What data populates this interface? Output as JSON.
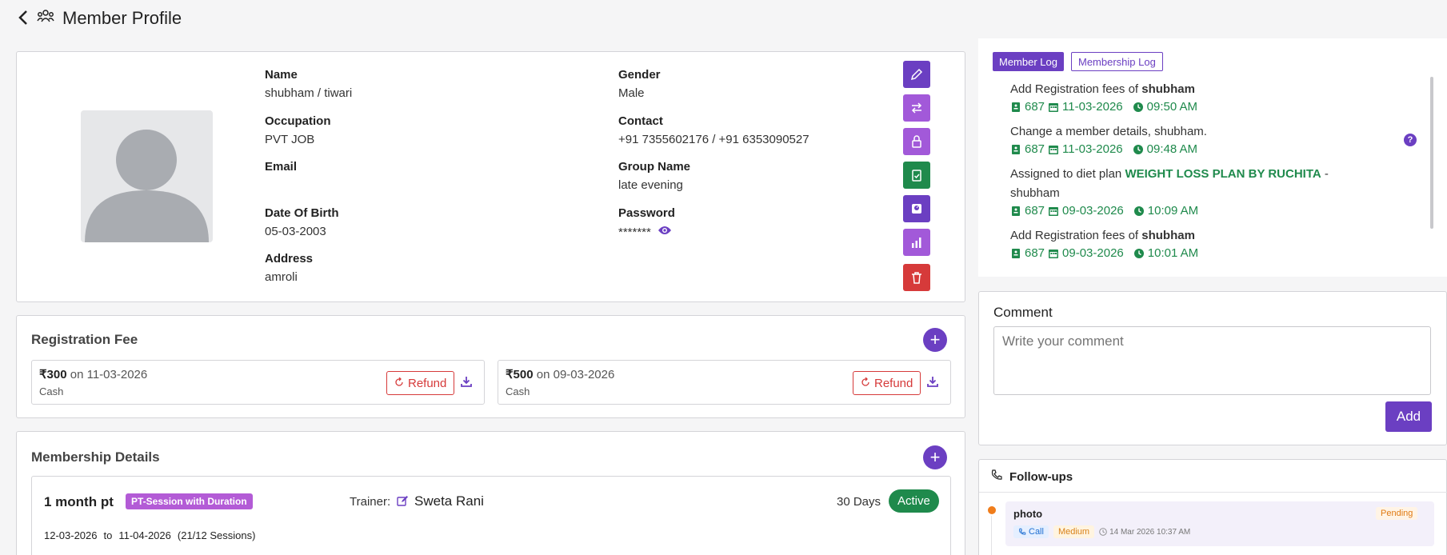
{
  "header": {
    "title": "Member Profile"
  },
  "profile": {
    "name_label": "Name",
    "name": "shubham / tiwari",
    "gender_label": "Gender",
    "gender": "Male",
    "occupation_label": "Occupation",
    "occupation": "PVT JOB",
    "contact_label": "Contact",
    "contact": "+91 7355602176 / +91 6353090527",
    "email_label": "Email",
    "email": "",
    "group_label": "Group Name",
    "group": "late evening",
    "dob_label": "Date Of Birth",
    "dob": "05-03-2003",
    "password_label": "Password",
    "password": "*******",
    "address_label": "Address",
    "address": "amroli"
  },
  "actions": {
    "colors": {
      "edit": "#6b3fc2",
      "transfer": "#a259d9",
      "lock": "#a259d9",
      "diet": "#1f8a4c",
      "measure": "#6b3fc2",
      "stats": "#a259d9",
      "delete": "#d63a3a"
    }
  },
  "registration": {
    "title": "Registration Fee",
    "fees": [
      {
        "amount": "₹300",
        "on": "on 11-03-2026",
        "mode": "Cash",
        "refund_label": "Refund"
      },
      {
        "amount": "₹500",
        "on": "on 09-03-2026",
        "mode": "Cash",
        "refund_label": "Refund"
      }
    ]
  },
  "membership": {
    "title": "Membership Details",
    "plan": "1 month pt",
    "tag": "PT-Session with Duration",
    "trainer_label": "Trainer:",
    "trainer": "Sweta Rani",
    "duration": "30 Days",
    "status": "Active",
    "start": "12-03-2026",
    "to": "to",
    "end": "11-04-2026",
    "sessions": "(21/12 Sessions)"
  },
  "logs": {
    "tabs": [
      "Member Log",
      "Membership Log"
    ],
    "entries": [
      {
        "pre": "Add Registration fees of ",
        "bold": "shubham",
        "post": "",
        "id": "687",
        "date": "11-03-2026",
        "time": "09:50 AM"
      },
      {
        "pre": "Change a member details, shubham.",
        "bold": "",
        "post": "",
        "id": "687",
        "date": "11-03-2026",
        "time": "09:48 AM"
      },
      {
        "pre": "Assigned to diet plan ",
        "bold": "WEIGHT LOSS PLAN BY RUCHITA",
        "post": " -",
        "line2": "shubham",
        "id": "687",
        "date": "09-03-2026",
        "time": "10:09 AM"
      },
      {
        "pre": "Add Registration fees of ",
        "bold": "shubham",
        "post": "",
        "id": "687",
        "date": "09-03-2026",
        "time": "10:01 AM"
      }
    ]
  },
  "comment": {
    "title": "Comment",
    "placeholder": "Write your comment",
    "add_label": "Add"
  },
  "followups": {
    "title": "Follow-ups",
    "item": {
      "name": "photo",
      "status": "Pending",
      "type": "Call",
      "priority": "Medium",
      "datetime": "14 Mar 2026 10:37 AM"
    }
  }
}
